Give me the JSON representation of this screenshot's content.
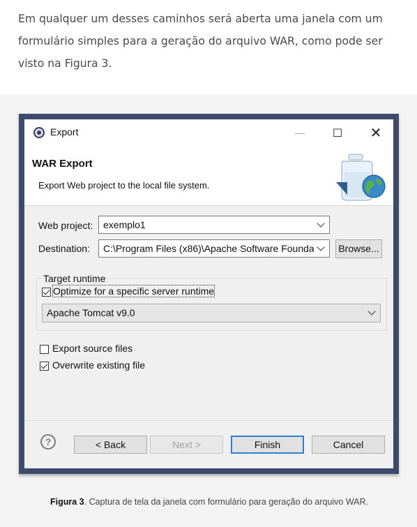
{
  "intro_text": "Em qualquer um desses caminhos será aberta uma janela com um formulário simples para a geração do arquivo WAR, como pode ser visto na Figura 3.",
  "dialog": {
    "window_title": "Export",
    "header_title": "WAR Export",
    "header_description": "Export Web project to the local file system.",
    "web_project_label": "Web project:",
    "web_project_value": "exemplo1",
    "destination_label": "Destination:",
    "destination_value": "C:\\Program Files (x86)\\Apache Software Founda",
    "browse_label": "Browse...",
    "target_runtime_group": "Target runtime",
    "optimize_label": "Optimize for a specific server runtime",
    "optimize_checked": true,
    "runtime_value": "Apache Tomcat v9.0",
    "export_source_label": "Export source files",
    "export_source_checked": false,
    "overwrite_label": "Overwrite existing file",
    "overwrite_checked": true,
    "help_glyph": "?",
    "back_label": "< Back",
    "next_label": "Next >",
    "finish_label": "Finish",
    "cancel_label": "Cancel",
    "window_controls": {
      "minimize": "—",
      "maximize": "☐",
      "close": "✕"
    }
  },
  "caption": {
    "figure_label": "Figura 3",
    "text": ". Captura de tela da janela com formulário para geração do arquivo WAR."
  },
  "icons": [
    "eclipse-app-icon",
    "war-export-banner-icon",
    "help-icon",
    "chevron-down-icon"
  ]
}
